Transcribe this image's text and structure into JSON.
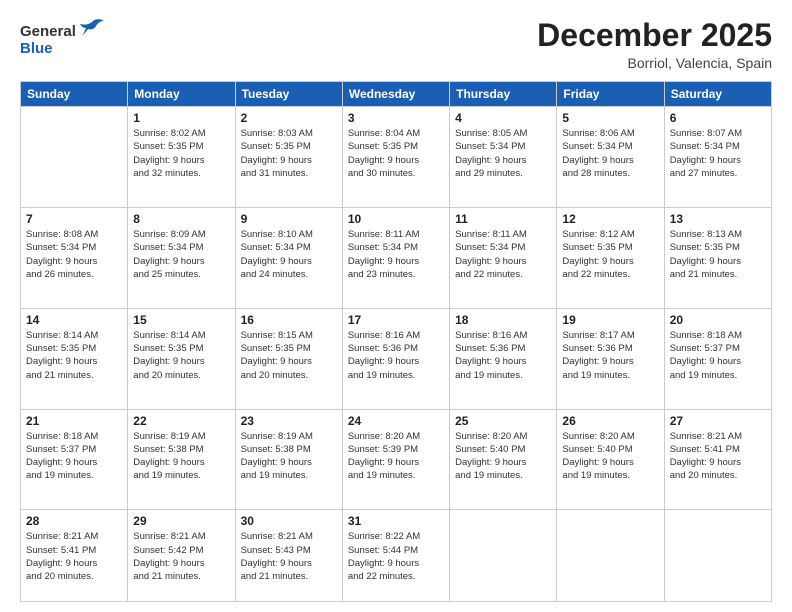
{
  "logo": {
    "general": "General",
    "blue": "Blue"
  },
  "header": {
    "month_year": "December 2025",
    "location": "Borriol, Valencia, Spain"
  },
  "weekdays": [
    "Sunday",
    "Monday",
    "Tuesday",
    "Wednesday",
    "Thursday",
    "Friday",
    "Saturday"
  ],
  "weeks": [
    [
      {
        "day": "",
        "info": ""
      },
      {
        "day": "1",
        "info": "Sunrise: 8:02 AM\nSunset: 5:35 PM\nDaylight: 9 hours\nand 32 minutes."
      },
      {
        "day": "2",
        "info": "Sunrise: 8:03 AM\nSunset: 5:35 PM\nDaylight: 9 hours\nand 31 minutes."
      },
      {
        "day": "3",
        "info": "Sunrise: 8:04 AM\nSunset: 5:35 PM\nDaylight: 9 hours\nand 30 minutes."
      },
      {
        "day": "4",
        "info": "Sunrise: 8:05 AM\nSunset: 5:34 PM\nDaylight: 9 hours\nand 29 minutes."
      },
      {
        "day": "5",
        "info": "Sunrise: 8:06 AM\nSunset: 5:34 PM\nDaylight: 9 hours\nand 28 minutes."
      },
      {
        "day": "6",
        "info": "Sunrise: 8:07 AM\nSunset: 5:34 PM\nDaylight: 9 hours\nand 27 minutes."
      }
    ],
    [
      {
        "day": "7",
        "info": "Sunrise: 8:08 AM\nSunset: 5:34 PM\nDaylight: 9 hours\nand 26 minutes."
      },
      {
        "day": "8",
        "info": "Sunrise: 8:09 AM\nSunset: 5:34 PM\nDaylight: 9 hours\nand 25 minutes."
      },
      {
        "day": "9",
        "info": "Sunrise: 8:10 AM\nSunset: 5:34 PM\nDaylight: 9 hours\nand 24 minutes."
      },
      {
        "day": "10",
        "info": "Sunrise: 8:11 AM\nSunset: 5:34 PM\nDaylight: 9 hours\nand 23 minutes."
      },
      {
        "day": "11",
        "info": "Sunrise: 8:11 AM\nSunset: 5:34 PM\nDaylight: 9 hours\nand 22 minutes."
      },
      {
        "day": "12",
        "info": "Sunrise: 8:12 AM\nSunset: 5:35 PM\nDaylight: 9 hours\nand 22 minutes."
      },
      {
        "day": "13",
        "info": "Sunrise: 8:13 AM\nSunset: 5:35 PM\nDaylight: 9 hours\nand 21 minutes."
      }
    ],
    [
      {
        "day": "14",
        "info": "Sunrise: 8:14 AM\nSunset: 5:35 PM\nDaylight: 9 hours\nand 21 minutes."
      },
      {
        "day": "15",
        "info": "Sunrise: 8:14 AM\nSunset: 5:35 PM\nDaylight: 9 hours\nand 20 minutes."
      },
      {
        "day": "16",
        "info": "Sunrise: 8:15 AM\nSunset: 5:35 PM\nDaylight: 9 hours\nand 20 minutes."
      },
      {
        "day": "17",
        "info": "Sunrise: 8:16 AM\nSunset: 5:36 PM\nDaylight: 9 hours\nand 19 minutes."
      },
      {
        "day": "18",
        "info": "Sunrise: 8:16 AM\nSunset: 5:36 PM\nDaylight: 9 hours\nand 19 minutes."
      },
      {
        "day": "19",
        "info": "Sunrise: 8:17 AM\nSunset: 5:36 PM\nDaylight: 9 hours\nand 19 minutes."
      },
      {
        "day": "20",
        "info": "Sunrise: 8:18 AM\nSunset: 5:37 PM\nDaylight: 9 hours\nand 19 minutes."
      }
    ],
    [
      {
        "day": "21",
        "info": "Sunrise: 8:18 AM\nSunset: 5:37 PM\nDaylight: 9 hours\nand 19 minutes."
      },
      {
        "day": "22",
        "info": "Sunrise: 8:19 AM\nSunset: 5:38 PM\nDaylight: 9 hours\nand 19 minutes."
      },
      {
        "day": "23",
        "info": "Sunrise: 8:19 AM\nSunset: 5:38 PM\nDaylight: 9 hours\nand 19 minutes."
      },
      {
        "day": "24",
        "info": "Sunrise: 8:20 AM\nSunset: 5:39 PM\nDaylight: 9 hours\nand 19 minutes."
      },
      {
        "day": "25",
        "info": "Sunrise: 8:20 AM\nSunset: 5:40 PM\nDaylight: 9 hours\nand 19 minutes."
      },
      {
        "day": "26",
        "info": "Sunrise: 8:20 AM\nSunset: 5:40 PM\nDaylight: 9 hours\nand 19 minutes."
      },
      {
        "day": "27",
        "info": "Sunrise: 8:21 AM\nSunset: 5:41 PM\nDaylight: 9 hours\nand 20 minutes."
      }
    ],
    [
      {
        "day": "28",
        "info": "Sunrise: 8:21 AM\nSunset: 5:41 PM\nDaylight: 9 hours\nand 20 minutes."
      },
      {
        "day": "29",
        "info": "Sunrise: 8:21 AM\nSunset: 5:42 PM\nDaylight: 9 hours\nand 21 minutes."
      },
      {
        "day": "30",
        "info": "Sunrise: 8:21 AM\nSunset: 5:43 PM\nDaylight: 9 hours\nand 21 minutes."
      },
      {
        "day": "31",
        "info": "Sunrise: 8:22 AM\nSunset: 5:44 PM\nDaylight: 9 hours\nand 22 minutes."
      },
      {
        "day": "",
        "info": ""
      },
      {
        "day": "",
        "info": ""
      },
      {
        "day": "",
        "info": ""
      }
    ]
  ]
}
